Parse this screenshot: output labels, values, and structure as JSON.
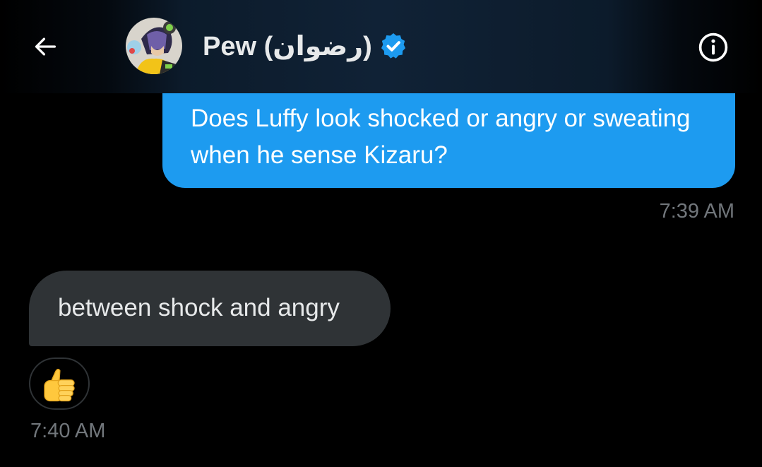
{
  "header": {
    "back_icon": "arrow-left-icon",
    "contact_name": "Pew (رضوان)",
    "verified_icon": "verified-badge-icon",
    "info_icon": "info-circle-icon"
  },
  "messages": [
    {
      "direction": "outgoing",
      "text": "Does Luffy look shocked or angry or sweating when he sense Kizaru?",
      "time": "7:39 AM"
    },
    {
      "direction": "incoming",
      "text": "between shock and angry",
      "reaction": "thumbs-up-emoji",
      "time": "7:40 AM"
    }
  ],
  "colors": {
    "background": "#000000",
    "outgoing_bubble": "#1d9bf0",
    "incoming_bubble": "#2f3336",
    "timestamp": "#71767b",
    "verified": "#1d9bf0"
  }
}
